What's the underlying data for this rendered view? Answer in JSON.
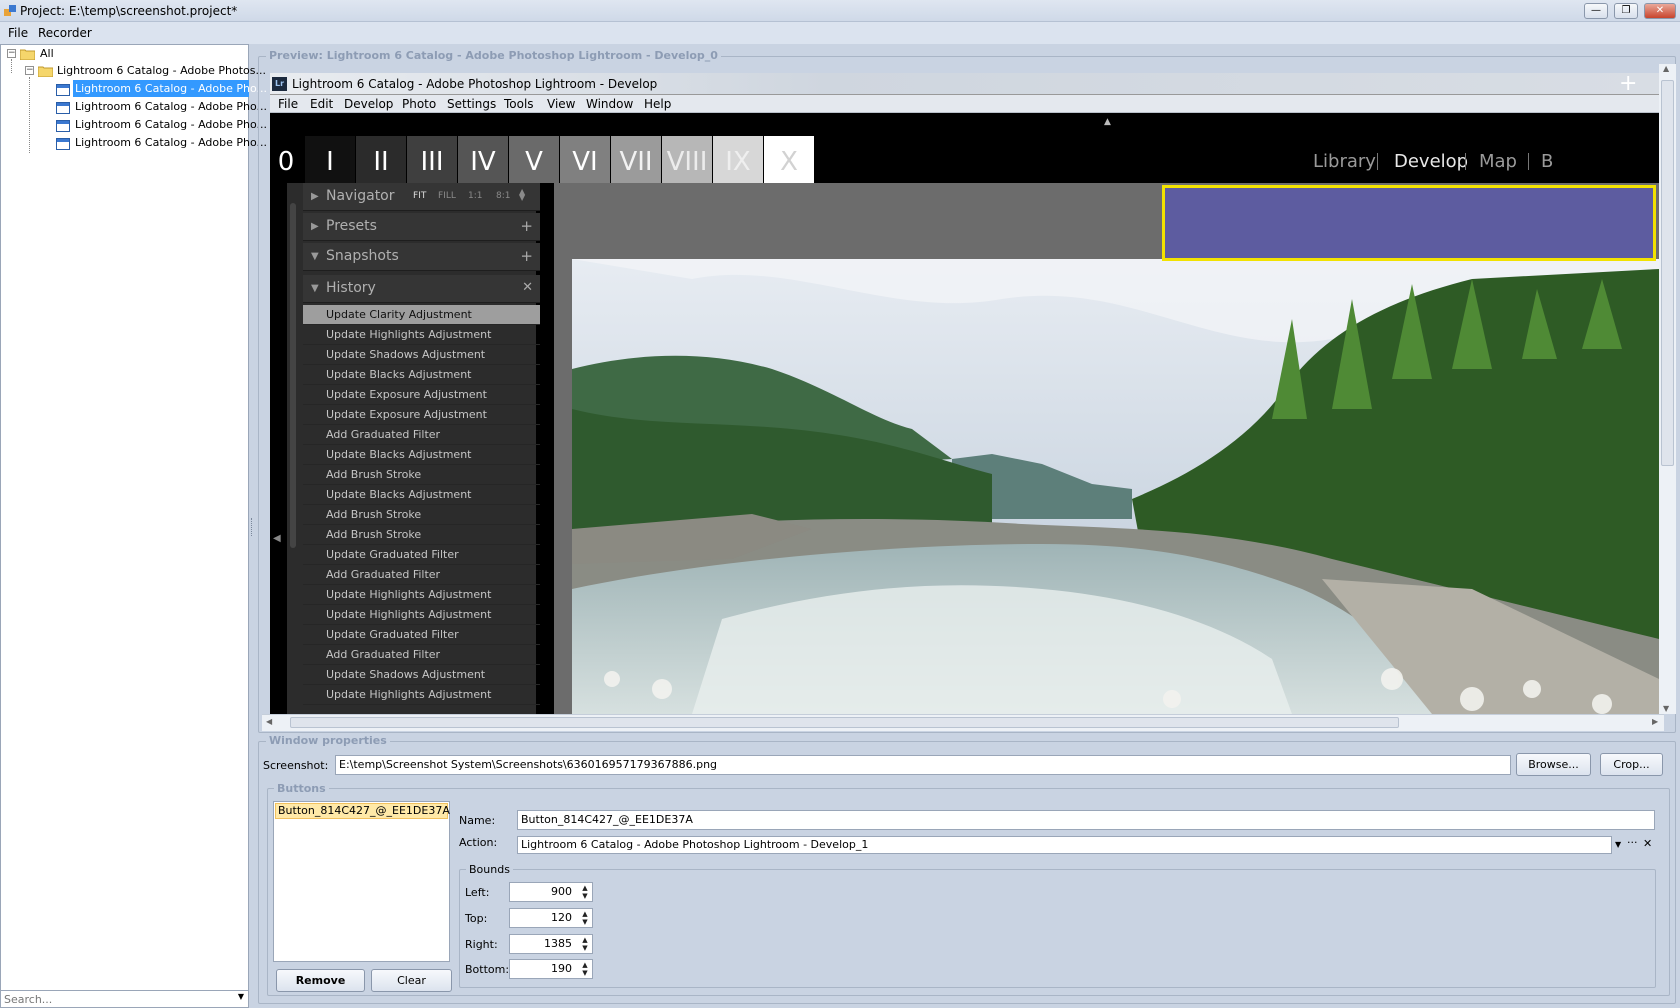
{
  "window": {
    "title": "Project: E:\\temp\\screenshot.project*",
    "controls": [
      "—",
      "❐",
      "✕"
    ]
  },
  "menu": [
    "File",
    "Recorder"
  ],
  "tree": {
    "root": "All",
    "folder": "Lightroom 6 Catalog - Adobe Photos...",
    "items": [
      "Lightroom 6 Catalog - Adobe Pho...",
      "Lightroom 6 Catalog - Adobe Pho...",
      "Lightroom 6 Catalog - Adobe Pho...",
      "Lightroom 6 Catalog - Adobe Pho..."
    ],
    "selected_index": 0
  },
  "search": {
    "placeholder": "Search..."
  },
  "preview": {
    "group_label": "Preview: Lightroom 6 Catalog - Adobe Photoshop Lightroom - Develop_0",
    "lr": {
      "title": "Lightroom 6 Catalog - Adobe Photoshop Lightroom - Develop",
      "logo": "Lr",
      "menu": [
        "File",
        "Edit",
        "Develop",
        "Photo",
        "Settings",
        "Tools",
        "View",
        "Window",
        "Help"
      ],
      "ratings": [
        "0",
        "I",
        "II",
        "III",
        "IV",
        "V",
        "VI",
        "VII",
        "VIII",
        "IX",
        "X"
      ],
      "modules": [
        "Library",
        "Develop",
        "Map",
        "B"
      ],
      "active_module": "Develop",
      "navigator": {
        "label": "Navigator",
        "zoom": [
          "FIT",
          "FILL",
          "1:1",
          "8:1"
        ]
      },
      "panels": {
        "presets": "Presets",
        "snapshots": "Snapshots",
        "history": "History"
      },
      "history": [
        "Update Clarity Adjustment",
        "Update Highlights Adjustment",
        "Update Shadows Adjustment",
        "Update Blacks Adjustment",
        "Update Exposure Adjustment",
        "Update Exposure Adjustment",
        "Add Graduated Filter",
        "Update Blacks Adjustment",
        "Add Brush Stroke",
        "Update Blacks Adjustment",
        "Add Brush Stroke",
        "Add Brush Stroke",
        "Update Graduated Filter",
        "Add Graduated Filter",
        "Update Highlights Adjustment",
        "Update Highlights Adjustment",
        "Update Graduated Filter",
        "Add Graduated Filter",
        "Update Shadows Adjustment",
        "Update Highlights Adjustment"
      ],
      "history_selected": 0
    },
    "highlight_color": "#5d5ca0",
    "highlight_border": "#f2e200"
  },
  "props": {
    "group_label": "Window properties",
    "screenshot_label": "Screenshot:",
    "screenshot_path": "E:\\temp\\Screenshot System\\Screenshots\\636016957179367886.png",
    "browse": "Browse...",
    "crop": "Crop...",
    "buttons_label": "Buttons",
    "button_item": "Button_814C427_@_EE1DE37A",
    "name_label": "Name:",
    "name_value": "Button_814C427_@_EE1DE37A",
    "action_label": "Action:",
    "action_value": "Lightroom 6 Catalog - Adobe Photoshop Lightroom - Develop_1",
    "bounds_label": "Bounds",
    "left_label": "Left:",
    "left": "900",
    "top_label": "Top:",
    "top": "120",
    "right_label": "Right:",
    "right": "1385",
    "bottom_label": "Bottom:",
    "bottom": "190",
    "remove": "Remove",
    "clear": "Clear"
  }
}
